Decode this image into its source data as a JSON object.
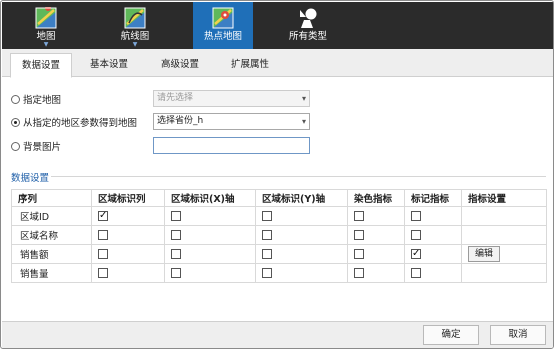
{
  "toolbar": {
    "items": [
      {
        "label": "地图",
        "icon": "map-icon",
        "active": false,
        "has_dropdown": true
      },
      {
        "label": "航线图",
        "icon": "route-map-icon",
        "active": false,
        "has_dropdown": true
      },
      {
        "label": "热点地图",
        "icon": "hotspot-map-icon",
        "active": true,
        "has_dropdown": false
      },
      {
        "label": "所有类型",
        "icon": "shapes-icon",
        "active": false,
        "has_dropdown": false
      }
    ],
    "active_color": "#1f6fb8",
    "background_color": "#2b2b2b"
  },
  "tabs": [
    {
      "label": "数据设置",
      "active": true
    },
    {
      "label": "基本设置",
      "active": false
    },
    {
      "label": "高级设置",
      "active": false
    },
    {
      "label": "扩展属性",
      "active": false
    }
  ],
  "options": {
    "specify_map": {
      "label": "指定地图",
      "selected": false,
      "select_placeholder": "请先选择"
    },
    "from_region": {
      "label": "从指定的地区参数得到地图",
      "selected": true,
      "select_value": "选择省份_h"
    },
    "background_image": {
      "label": "背景图片",
      "selected": false,
      "value": ""
    }
  },
  "data_section": {
    "title": "数据设置",
    "columns": [
      "序列",
      "区域标识列",
      "区域标识(X)轴",
      "区域标识(Y)轴",
      "染色指标",
      "标记指标",
      "指标设置"
    ],
    "rows": [
      {
        "name": "区域ID",
        "checks": [
          true,
          false,
          false,
          false,
          false
        ],
        "edit": ""
      },
      {
        "name": "区域名称",
        "checks": [
          false,
          false,
          false,
          false,
          false
        ],
        "edit": ""
      },
      {
        "name": "销售额",
        "checks": [
          false,
          false,
          false,
          false,
          true
        ],
        "edit": "编辑"
      },
      {
        "name": "销售量",
        "checks": [
          false,
          false,
          false,
          false,
          false
        ],
        "edit": ""
      }
    ]
  },
  "footer": {
    "ok_label": "确定",
    "cancel_label": "取消"
  }
}
